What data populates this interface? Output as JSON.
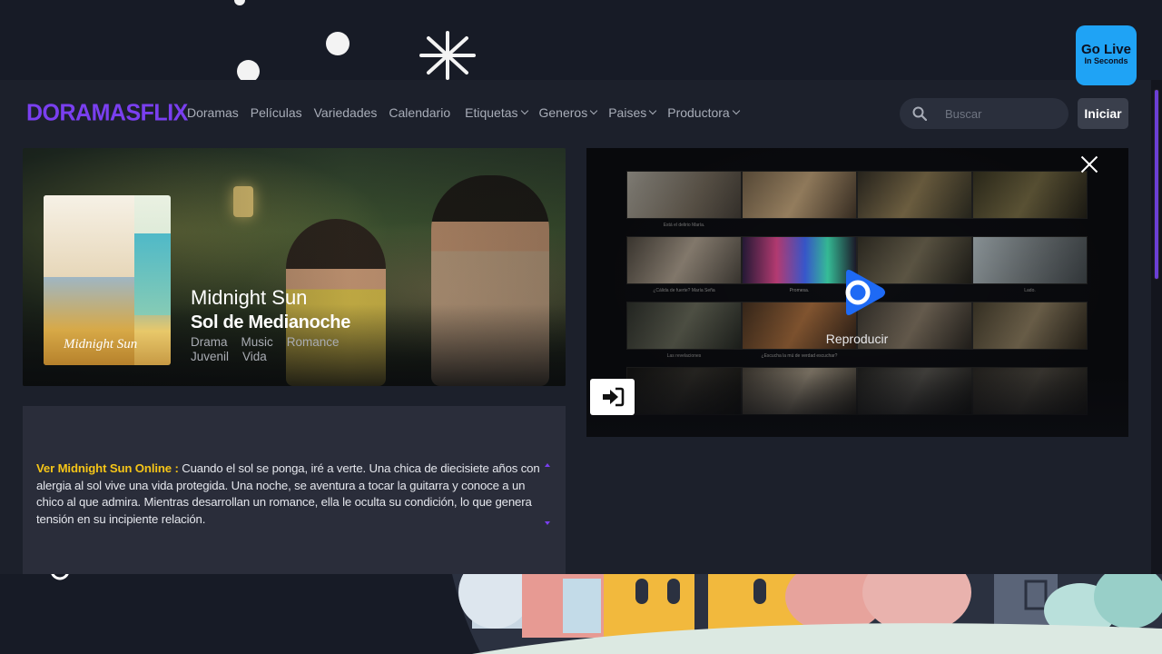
{
  "overlay_ad": {
    "title": "Go Live",
    "subtitle": "In Seconds"
  },
  "header": {
    "logo": "DORAMASFLIX",
    "nav": [
      {
        "label": "Doramas",
        "dropdown": false
      },
      {
        "label": "Películas",
        "dropdown": false
      },
      {
        "label": "Variedades",
        "dropdown": false
      },
      {
        "label": "Calendario",
        "dropdown": false
      },
      {
        "label": "Etiquetas",
        "dropdown": true
      },
      {
        "label": "Generos",
        "dropdown": true
      },
      {
        "label": "Paises",
        "dropdown": true
      },
      {
        "label": "Productora",
        "dropdown": true
      }
    ],
    "search_placeholder": "Buscar",
    "login_label": "Iniciar"
  },
  "hero": {
    "poster_title": "Midnight Sun",
    "title": "Midnight Sun",
    "subtitle": "Sol de Medianoche",
    "genres": [
      "Drama",
      "Music",
      "Romance",
      "Juvenil",
      "Vida"
    ]
  },
  "player": {
    "play_label": "Reproducir",
    "thumb_captions": [
      "Está el delirio María.",
      "",
      "",
      "",
      "¿Cálida de fuerte? María Seña",
      "Promesa.",
      "",
      "Lado.",
      "Las revelaciones",
      "¿Escucha la mú de verdad escuchar?",
      "",
      "",
      "",
      "",
      "",
      ""
    ]
  },
  "description": {
    "lead": "Ver Midnight Sun Online :",
    "text": " Cuando el sol se ponga, iré a verte. Una chica de diecisiete años con alergia al sol vive una vida protegida. Una noche, se aventura a tocar la guitarra y conoce a un chico al que admira. Mientras desarrollan un romance, ella le oculta su condición, lo que genera tensión en su incipiente relación."
  },
  "colors": {
    "brand": "#7a3ff0",
    "accent": "#f5c518",
    "ad": "#1fa3f5",
    "play": "#1e6af5"
  }
}
